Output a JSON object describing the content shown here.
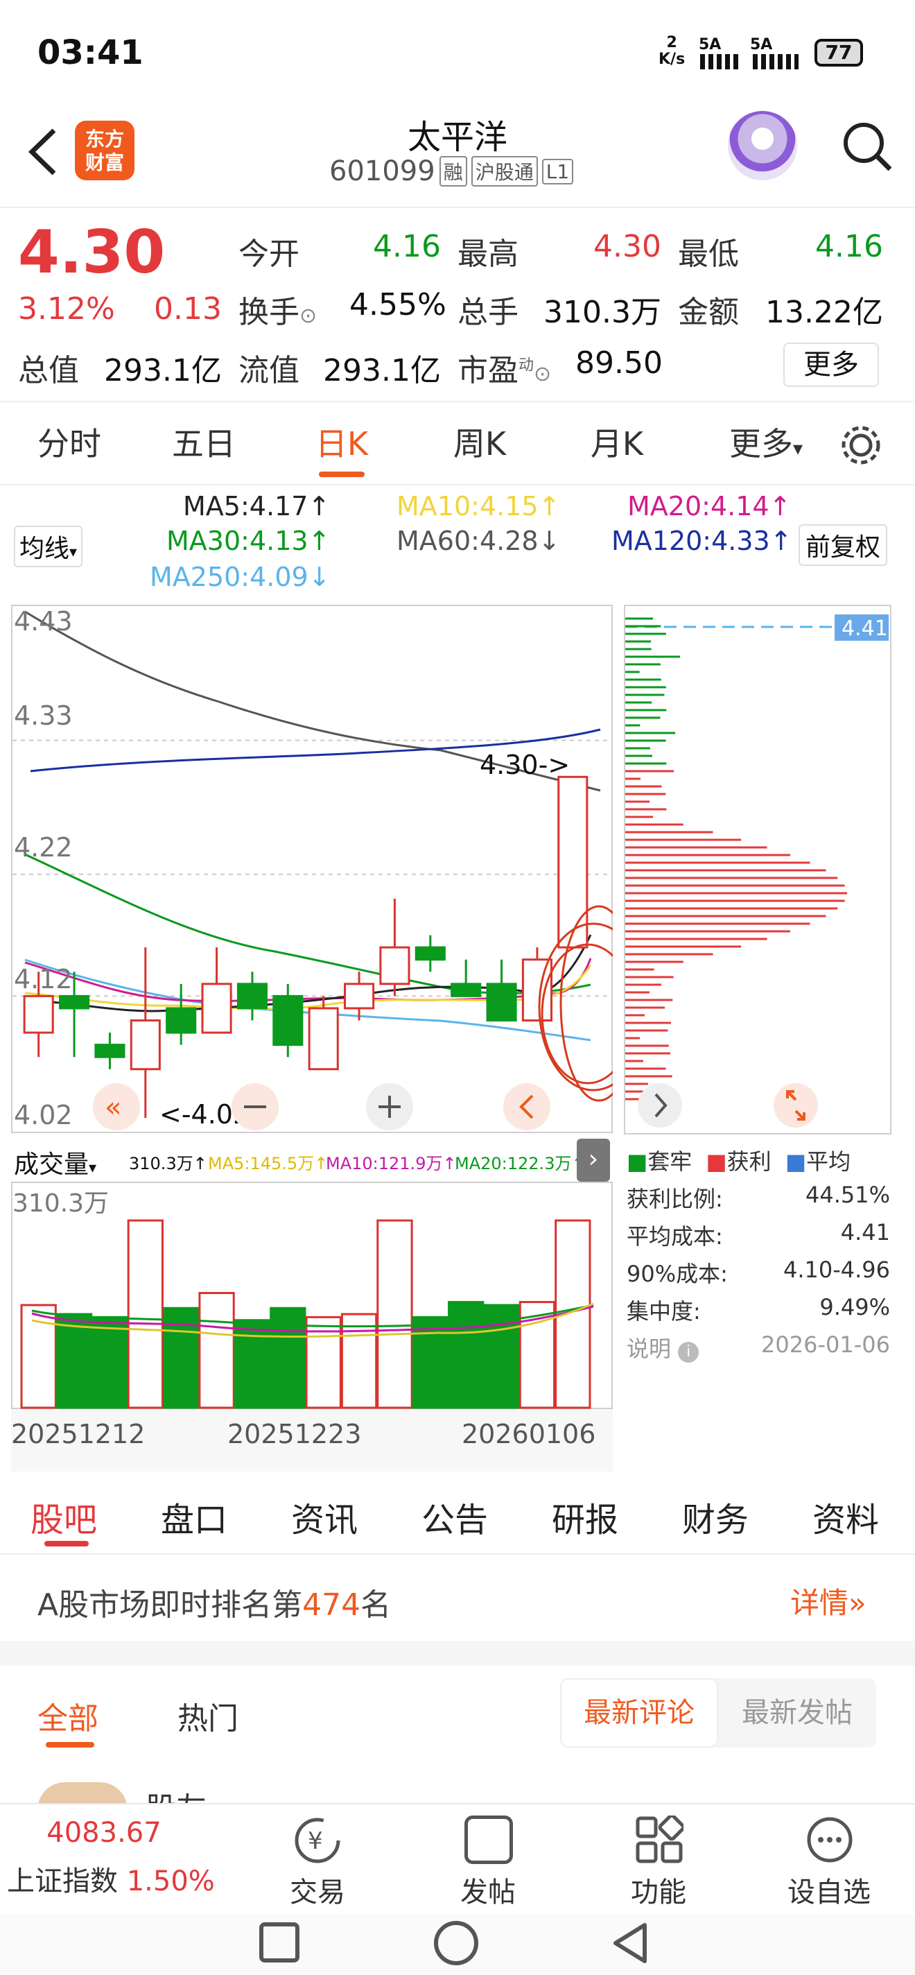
{
  "status": {
    "time": "03:41",
    "speed": "2",
    "speed_unit": "K/s",
    "sig1": "5A",
    "sig2": "5A",
    "battery": "77"
  },
  "header": {
    "logo_line1": "东方",
    "logo_line2": "财富",
    "name": "太平洋",
    "code": "601099",
    "tag_margin": "融",
    "tag_connect": "沪股通",
    "tag_level": "L1"
  },
  "quote": {
    "price": "4.30",
    "pct": "3.12%",
    "change": "0.13",
    "open_label": "今开",
    "open": "4.16",
    "high_label": "最高",
    "high": "4.30",
    "low_label": "最低",
    "low": "4.16",
    "turnover_label": "换手",
    "turnover": "4.55%",
    "volume_label": "总手",
    "volume": "310.3万",
    "amount_label": "金额",
    "amount": "13.22亿",
    "mktcap_label": "总值",
    "mktcap": "293.1亿",
    "float_label": "流值",
    "float": "293.1亿",
    "pe_label": "市盈",
    "pe_sup": "动",
    "pe": "89.50",
    "more": "更多"
  },
  "period_tabs": [
    "分时",
    "五日",
    "日K",
    "周K",
    "月K",
    "更多"
  ],
  "ma_legend": {
    "selector": "均线",
    "adjust": "前复权",
    "ma5": "MA5:4.17↑",
    "ma10": "MA10:4.15↑",
    "ma20": "MA20:4.14↑",
    "ma30": "MA30:4.13↑",
    "ma60": "MA60:4.28↓",
    "ma120": "MA120:4.33↑",
    "ma250": "MA250:4.09↓",
    "colors": {
      "ma5": "#222222",
      "ma10": "#f2d43a",
      "ma20": "#d01c8b",
      "ma30": "#0a9a1e",
      "ma60": "#555555",
      "ma120": "#1a2fa0",
      "ma250": "#5ab4ec"
    }
  },
  "chart_data": {
    "type": "candlestick",
    "y_ticks": [
      "4.43",
      "4.33",
      "4.22",
      "4.12",
      "4.02"
    ],
    "ylim": [
      4.02,
      4.43
    ],
    "high_marker": "4.30->",
    "low_marker": "<-4.02",
    "candles": [
      {
        "o": 4.09,
        "h": 4.14,
        "l": 4.07,
        "c": 4.12
      },
      {
        "o": 4.12,
        "h": 4.14,
        "l": 4.07,
        "c": 4.11
      },
      {
        "o": 4.08,
        "h": 4.09,
        "l": 4.06,
        "c": 4.07
      },
      {
        "o": 4.06,
        "h": 4.16,
        "l": 4.02,
        "c": 4.1
      },
      {
        "o": 4.11,
        "h": 4.13,
        "l": 4.08,
        "c": 4.09
      },
      {
        "o": 4.09,
        "h": 4.16,
        "l": 4.09,
        "c": 4.13
      },
      {
        "o": 4.13,
        "h": 4.14,
        "l": 4.1,
        "c": 4.11
      },
      {
        "o": 4.12,
        "h": 4.13,
        "l": 4.07,
        "c": 4.08
      },
      {
        "o": 4.06,
        "h": 4.12,
        "l": 4.06,
        "c": 4.11
      },
      {
        "o": 4.11,
        "h": 4.14,
        "l": 4.1,
        "c": 4.13
      },
      {
        "o": 4.13,
        "h": 4.2,
        "l": 4.12,
        "c": 4.16
      },
      {
        "o": 4.16,
        "h": 4.17,
        "l": 4.14,
        "c": 4.15
      },
      {
        "o": 4.13,
        "h": 4.15,
        "l": 4.12,
        "c": 4.12
      },
      {
        "o": 4.13,
        "h": 4.15,
        "l": 4.1,
        "c": 4.1
      },
      {
        "o": 4.1,
        "h": 4.16,
        "l": 4.1,
        "c": 4.15
      },
      {
        "o": 4.16,
        "h": 4.3,
        "l": 4.16,
        "c": 4.3
      }
    ],
    "volume": {
      "label": "成交量",
      "max_label": "310.3万",
      "vol": "310.3万↑",
      "ma5": "MA5:145.5万↑",
      "ma10": "MA10:121.9万↑",
      "ma20": "MA20:122.3万↑",
      "bars": [
        170,
        155,
        150,
        310,
        165,
        190,
        145,
        165,
        150,
        155,
        310,
        150,
        175,
        170,
        175,
        310
      ]
    },
    "dates": [
      "20251212",
      "20251223",
      "20260106"
    ]
  },
  "chips": {
    "price": "4.41",
    "legend_trap": "套牢",
    "legend_profit": "获利",
    "legend_avg": "平均",
    "rows": [
      {
        "k": "获利比例:",
        "v": "44.51%"
      },
      {
        "k": "平均成本:",
        "v": "4.41"
      },
      {
        "k": "90%成本:",
        "v": "4.10-4.96"
      },
      {
        "k": "集中度:",
        "v": "9.49%"
      },
      {
        "k": "说明",
        "v": "2026-01-06"
      }
    ]
  },
  "bottom_tabs": [
    "股吧",
    "盘口",
    "资讯",
    "公告",
    "研报",
    "财务",
    "资料"
  ],
  "rank": {
    "prefix": "A股市场即时排名第",
    "num": "474",
    "suffix": "名",
    "detail": "详情"
  },
  "feed": {
    "tab_all": "全部",
    "tab_hot": "热门",
    "latest_comment": "最新评论",
    "latest_post": "最新发帖",
    "user": "股友"
  },
  "index": {
    "value": "4083.67",
    "name": "上证指数",
    "pct": "1.50%"
  },
  "actions": [
    "交易",
    "发帖",
    "功能",
    "设自选"
  ]
}
